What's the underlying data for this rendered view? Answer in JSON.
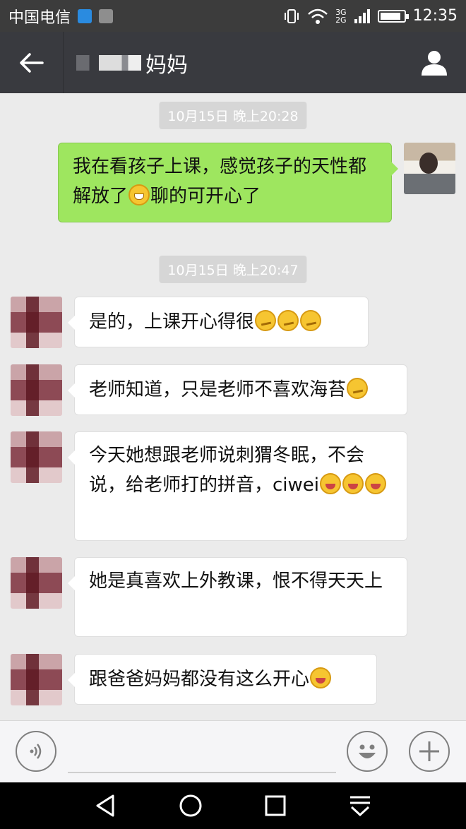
{
  "status_bar": {
    "carrier": "中国电信",
    "network": [
      "3G",
      "2G"
    ],
    "battery_level": 0.9,
    "time": "12:35"
  },
  "title_bar": {
    "back_icon": "back-arrow-icon",
    "title": "妈妈",
    "profile_icon": "person-icon"
  },
  "chat": {
    "timestamps": [
      "10月15日 晚上20:28",
      "10月15日 晚上20:47"
    ],
    "messages": [
      {
        "sender": "me",
        "text_a": "我在看孩子上课，感觉孩子的天性都解放了",
        "text_b": "聊的可开心了",
        "emoji": [
          "grin"
        ]
      },
      {
        "sender": "other",
        "text": "是的，上课开心得很",
        "emoji": [
          "smirk",
          "smirk",
          "smirk"
        ]
      },
      {
        "sender": "other",
        "text": "老师知道，只是老师不喜欢海苔",
        "emoji": [
          "smirk"
        ]
      },
      {
        "sender": "other",
        "text": "今天她想跟老师说刺猬冬眠，不会说，给老师打的拼音，ciwei",
        "emoji": [
          "laugh",
          "laugh",
          "laugh"
        ]
      },
      {
        "sender": "other",
        "text": "她是真喜欢上外教课，恨不得天天上",
        "emoji": []
      },
      {
        "sender": "other",
        "text": "跟爸爸妈妈都没有这么开心",
        "emoji": [
          "laugh"
        ]
      }
    ]
  },
  "input_bar": {
    "voice_icon": "voice-icon",
    "emoji_icon": "smiley-icon",
    "plus_icon": "plus-icon"
  },
  "nav_bar": {
    "icons": [
      "back-triangle-icon",
      "home-circle-icon",
      "recents-square-icon",
      "notification-pull-icon"
    ]
  },
  "colors": {
    "title_bg": "#393a3f",
    "chat_bg": "#ebebeb",
    "bubble_me": "#9ee65f",
    "bubble_other": "#ffffff"
  }
}
